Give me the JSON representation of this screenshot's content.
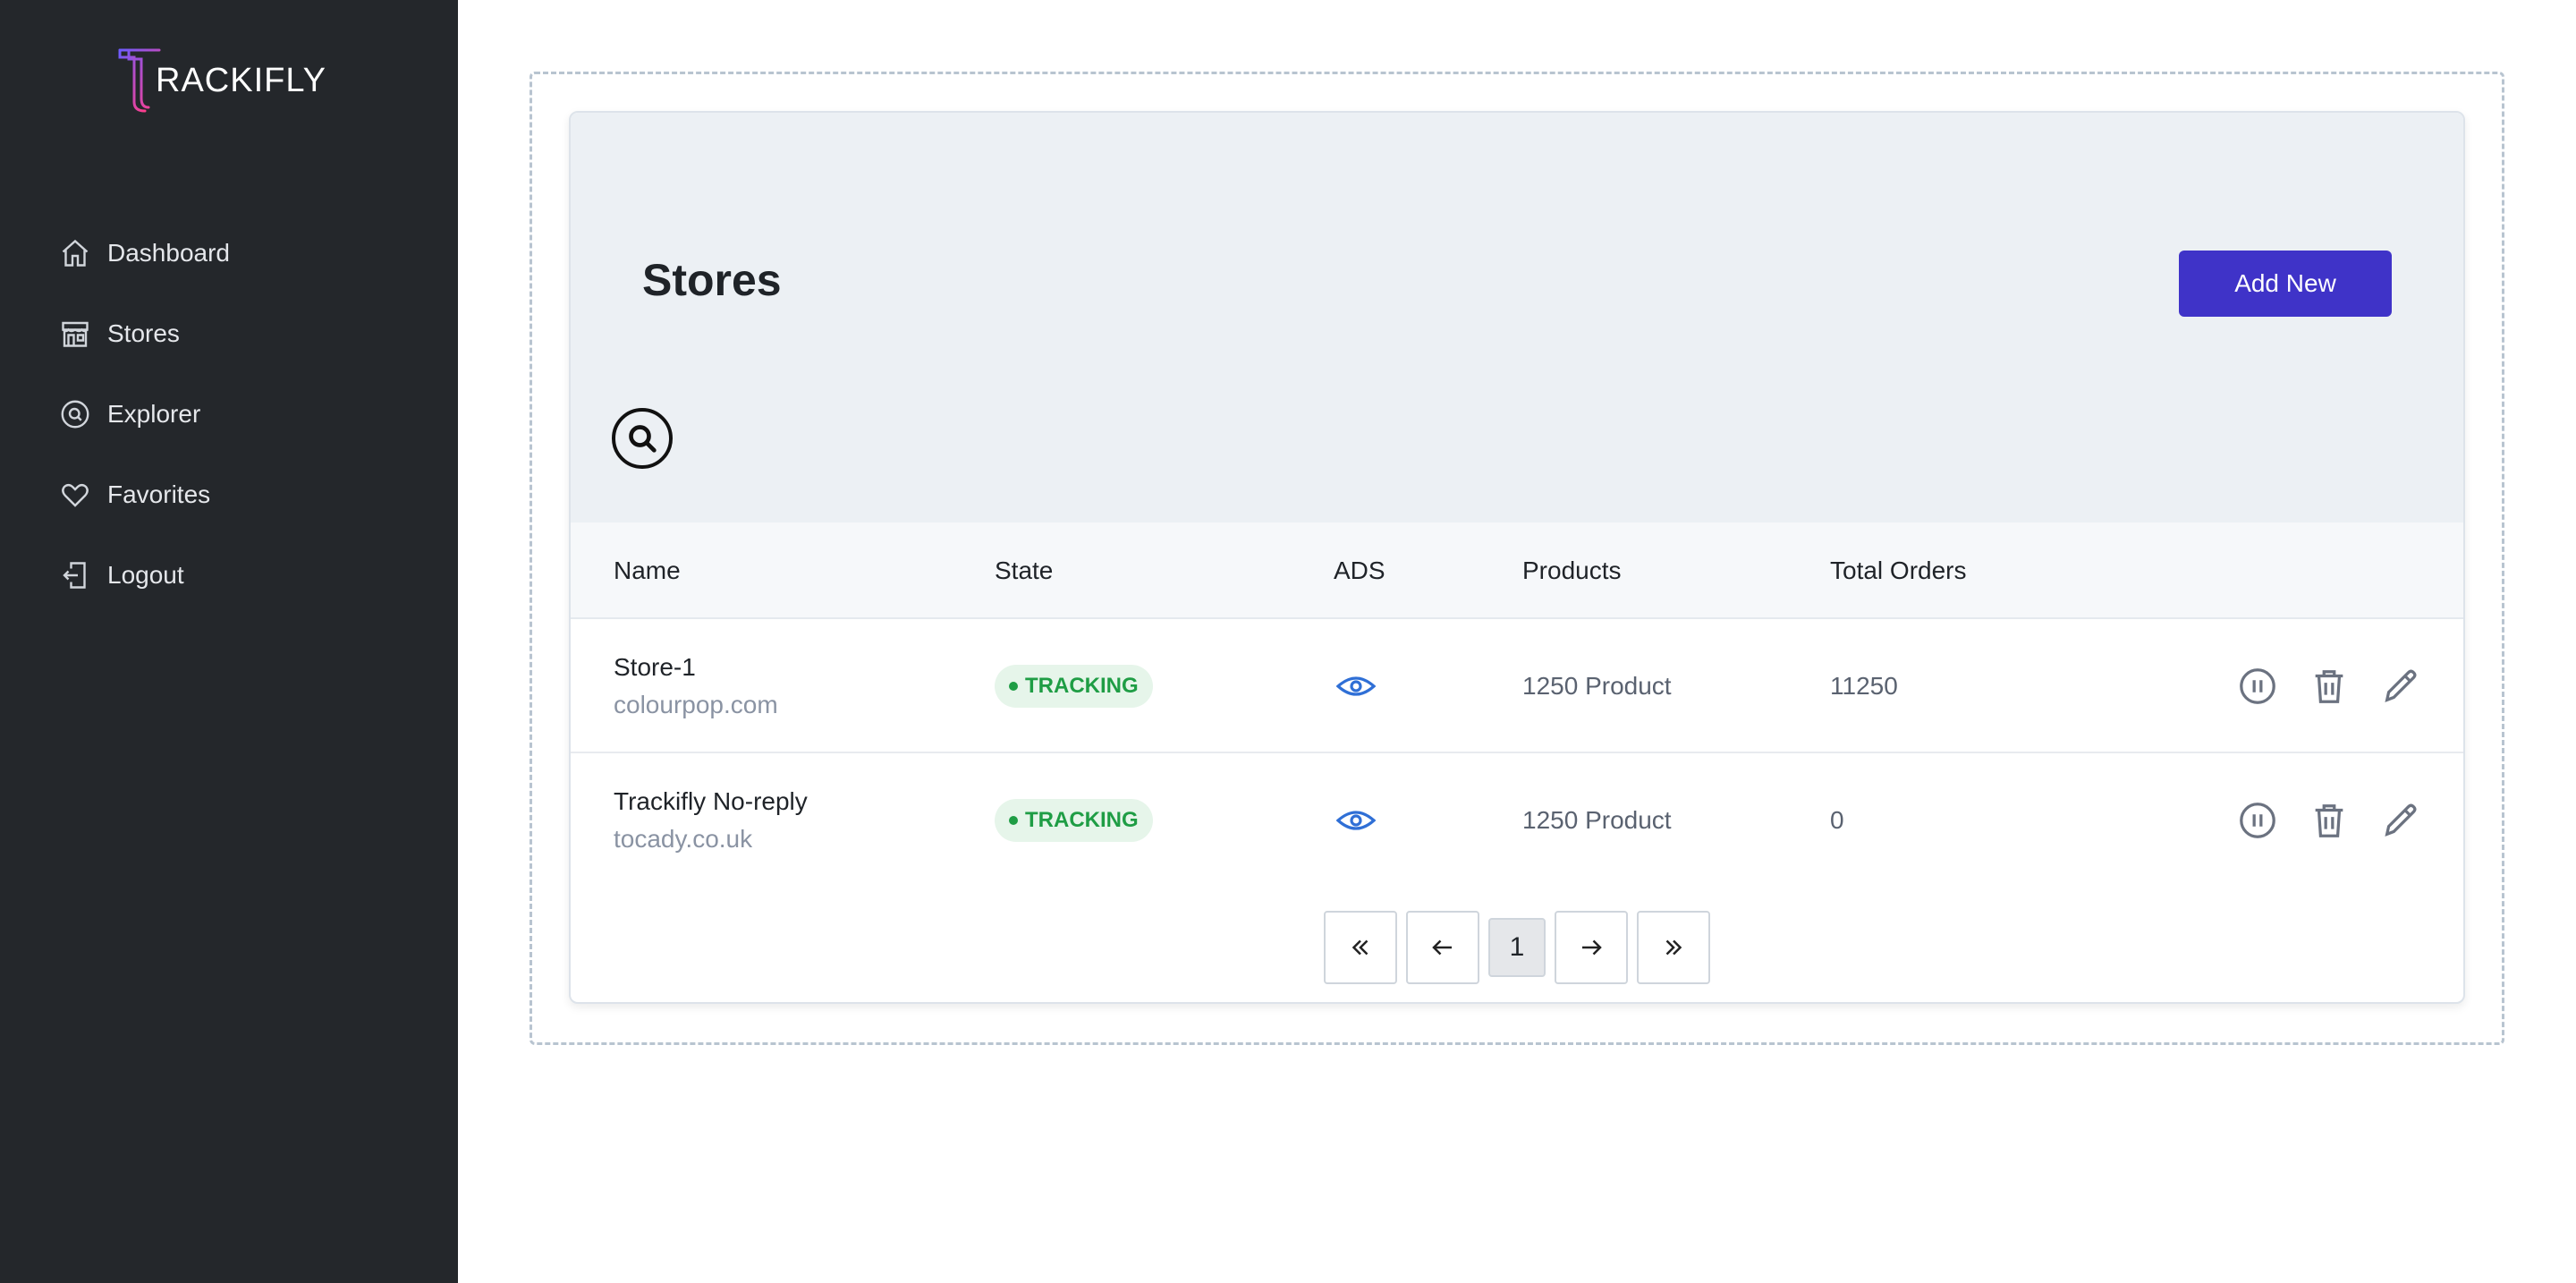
{
  "app": {
    "logo_text": "RACKIFLY",
    "logo_initial": "T"
  },
  "sidebar": {
    "items": [
      {
        "label": "Dashboard",
        "icon": "home-icon"
      },
      {
        "label": "Stores",
        "icon": "store-icon"
      },
      {
        "label": "Explorer",
        "icon": "compass-search-icon"
      },
      {
        "label": "Favorites",
        "icon": "heart-icon"
      },
      {
        "label": "Logout",
        "icon": "logout-icon"
      }
    ]
  },
  "main": {
    "title": "Stores",
    "add_button": "Add New",
    "table": {
      "columns": [
        "Name",
        "State",
        "ADS",
        "Products",
        "Total Orders"
      ],
      "rows": [
        {
          "name": "Store-1",
          "domain": "colourpop.com",
          "state": "TRACKING",
          "products": "1250 Product",
          "orders": "11250"
        },
        {
          "name": "Trackifly No-reply",
          "domain": "tocady.co.uk",
          "state": "TRACKING",
          "products": "1250 Product",
          "orders": "0"
        }
      ]
    },
    "pagination": {
      "current_page": "1"
    }
  },
  "colors": {
    "sidebar_bg": "#24272b",
    "accent": "#3f33c8",
    "tracking": "#1f9d45",
    "eye": "#2f6fd6"
  }
}
